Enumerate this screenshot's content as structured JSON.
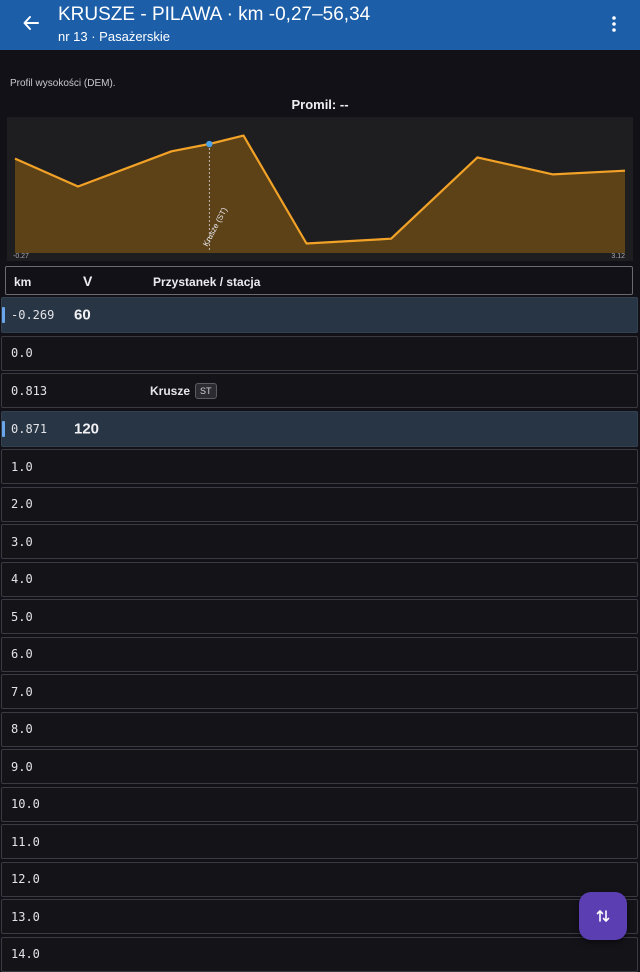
{
  "appbar": {
    "title": "KRUSZE - PILAWA · km -0,27–56,34",
    "subtitle": "nr 13 · Pasażerskie",
    "back_icon": "arrow-back-icon",
    "menu_icon": "more-vert-icon",
    "color": "#1c5ea8"
  },
  "profile": {
    "label": "Profil wysokości (DEM).",
    "promil": "Promil: --"
  },
  "chart_data": {
    "type": "area",
    "x_min_label": "-0.27",
    "x_max_label": "3.12",
    "xlim": [
      -0.27,
      3.12
    ],
    "x": [
      -0.27,
      0.08,
      0.6,
      0.81,
      1.0,
      1.35,
      1.82,
      2.3,
      2.72,
      3.12
    ],
    "y": [
      0.77,
      0.54,
      0.83,
      0.89,
      0.96,
      0.07,
      0.11,
      0.78,
      0.64,
      0.67
    ],
    "ylim": [
      0,
      1.08
    ],
    "annotations": [
      {
        "x": 0.81,
        "text": "Krusze (ST)"
      }
    ],
    "line_color": "#f2a227",
    "fill_color": "#5d4218",
    "background": "#1e1e21"
  },
  "table": {
    "headers": {
      "km": "km",
      "v": "V",
      "stop": "Przystanek / stacja"
    },
    "rows": [
      {
        "km": "-0.269",
        "v": "60",
        "stop": "",
        "badge": "",
        "speed": true
      },
      {
        "km": "0.0",
        "v": "",
        "stop": "",
        "badge": "",
        "speed": false
      },
      {
        "km": "0.813",
        "v": "",
        "stop": "Krusze",
        "badge": "ST",
        "speed": false
      },
      {
        "km": "0.871",
        "v": "120",
        "stop": "",
        "badge": "",
        "speed": true
      },
      {
        "km": "1.0",
        "v": "",
        "stop": "",
        "badge": "",
        "speed": false
      },
      {
        "km": "2.0",
        "v": "",
        "stop": "",
        "badge": "",
        "speed": false
      },
      {
        "km": "3.0",
        "v": "",
        "stop": "",
        "badge": "",
        "speed": false
      },
      {
        "km": "4.0",
        "v": "",
        "stop": "",
        "badge": "",
        "speed": false
      },
      {
        "km": "5.0",
        "v": "",
        "stop": "",
        "badge": "",
        "speed": false
      },
      {
        "km": "6.0",
        "v": "",
        "stop": "",
        "badge": "",
        "speed": false
      },
      {
        "km": "7.0",
        "v": "",
        "stop": "",
        "badge": "",
        "speed": false
      },
      {
        "km": "8.0",
        "v": "",
        "stop": "",
        "badge": "",
        "speed": false
      },
      {
        "km": "9.0",
        "v": "",
        "stop": "",
        "badge": "",
        "speed": false
      },
      {
        "km": "10.0",
        "v": "",
        "stop": "",
        "badge": "",
        "speed": false
      },
      {
        "km": "11.0",
        "v": "",
        "stop": "",
        "badge": "",
        "speed": false
      },
      {
        "km": "12.0",
        "v": "",
        "stop": "",
        "badge": "",
        "speed": false
      },
      {
        "km": "13.0",
        "v": "",
        "stop": "",
        "badge": "",
        "speed": false
      },
      {
        "km": "14.0",
        "v": "",
        "stop": "",
        "badge": "",
        "speed": false
      }
    ]
  },
  "fab": {
    "icon": "swap-vert-icon",
    "color": "#5b3fb2"
  }
}
